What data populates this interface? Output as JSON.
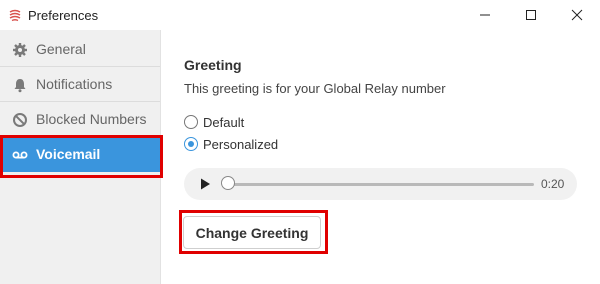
{
  "window": {
    "title": "Preferences",
    "icon": "app-logo-icon",
    "controls": [
      "minimize-icon",
      "maximize-icon",
      "close-icon"
    ]
  },
  "sidebar": {
    "items": [
      {
        "label": "General",
        "icon": "gear-icon",
        "active": false
      },
      {
        "label": "Notifications",
        "icon": "bell-icon",
        "active": false
      },
      {
        "label": "Blocked Numbers",
        "icon": "block-icon",
        "active": false
      },
      {
        "label": "Voicemail",
        "icon": "voicemail-icon",
        "active": true
      }
    ]
  },
  "greeting": {
    "heading": "Greeting",
    "description": "This greeting is for your Global Relay number",
    "options": [
      {
        "label": "Default",
        "checked": false
      },
      {
        "label": "Personalized",
        "checked": true
      }
    ],
    "player": {
      "time": "0:20",
      "progress": 0
    },
    "change_button": "Change Greeting"
  },
  "colors": {
    "accent": "#3a95dd",
    "highlight": "#e00000",
    "sidebar_bg": "#f0f0f0"
  }
}
